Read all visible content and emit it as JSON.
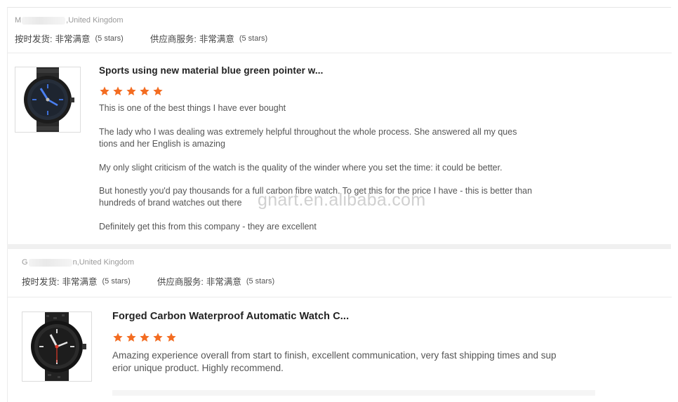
{
  "reviews": [
    {
      "buyer": {
        "prefix": "M",
        "suffix": ",United Kingdom"
      },
      "ratings": {
        "delivery_label": "按时发货:",
        "delivery_value": "非常满意",
        "delivery_stars": "(5 stars)",
        "service_label": "供应商服务:",
        "service_value": "非常满意",
        "service_stars": "(5 stars)"
      },
      "product_title": "Sports using new material blue green pointer w...",
      "rating": 5,
      "paragraphs": [
        "This is one of the best things I have ever bought",
        "The lady who I was dealing was extremely helpful throughout the whole process. She answered all my ques tions and her English is amazing",
        "My only slight criticism of the watch is the quality of the winder where you set the time: it could be better.",
        "But honestly you'd pay thousands for a full carbon fibre watch. To get this for the price I have - this is better than hundreds of brand watches out there",
        "Definitely get this from this company - they are excellent"
      ]
    },
    {
      "buyer": {
        "prefix": "G",
        "suffix": "n,United Kingdom"
      },
      "ratings": {
        "delivery_label": "按时发货:",
        "delivery_value": "非常满意",
        "delivery_stars": "(5 stars)",
        "service_label": "供应商服务:",
        "service_value": "非常满意",
        "service_stars": "(5 stars)"
      },
      "product_title": "Forged Carbon Waterproof Automatic Watch C...",
      "rating": 5,
      "paragraphs": [
        "Amazing experience overall from start to finish, excellent communication, very fast shipping times and sup erior unique product. Highly recommend."
      ]
    }
  ],
  "watermark": "gnart.en.alibaba.com",
  "colors": {
    "star": "#f36c21",
    "title": "#222222",
    "text": "#555555"
  },
  "icons": {
    "star": "star-icon"
  }
}
